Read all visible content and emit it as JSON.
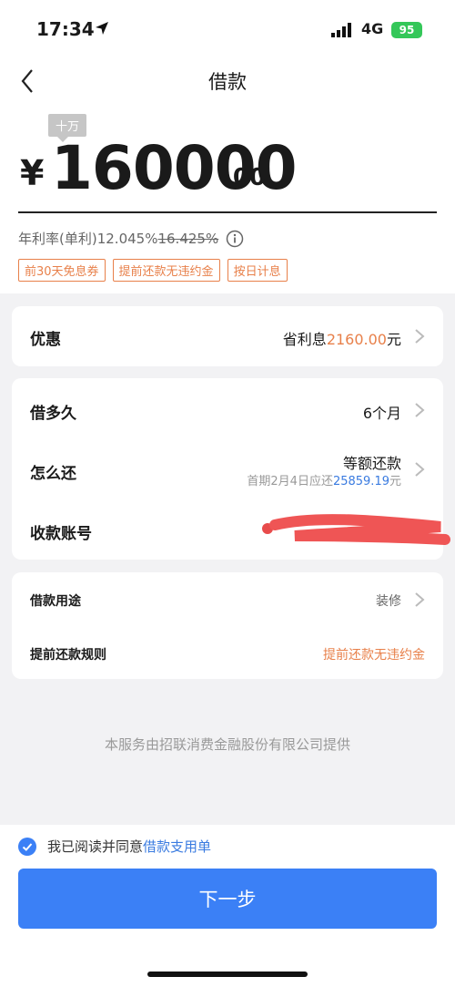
{
  "status_bar": {
    "time": "17:34",
    "network": "4G",
    "battery": "95"
  },
  "nav": {
    "title": "借款"
  },
  "amount": {
    "unit_tag": "十万",
    "currency": "¥",
    "integer": "160000",
    "decimal": ".00"
  },
  "rate": {
    "label": "年利率(单利)",
    "current": "12.045%",
    "original": "16.425%"
  },
  "tags": [
    "前30天免息券",
    "提前还款无违约金",
    "按日计息"
  ],
  "discount": {
    "label": "优惠",
    "prefix": "省利息",
    "amount": "2160.00",
    "suffix": "元"
  },
  "loan": {
    "term_label": "借多久",
    "term_value": "6个月",
    "repay_label": "怎么还",
    "repay_value": "等额还款",
    "repay_note_prefix": "首期2月4日应还",
    "repay_note_amount": "25859.19",
    "repay_note_suffix": "元",
    "account_label": "收款账号"
  },
  "details": {
    "purpose_label": "借款用途",
    "purpose_value": "装修",
    "prepay_label": "提前还款规则",
    "prepay_value": "提前还款无违约金"
  },
  "provider": "本服务由招联消费金融股份有限公司提供",
  "agreement": {
    "prefix": "我已阅读并同意",
    "link": "借款支用单"
  },
  "next_button": "下一步",
  "colors": {
    "accent": "#3b80f6",
    "orange": "#e8804a",
    "link": "#3a7be0"
  }
}
